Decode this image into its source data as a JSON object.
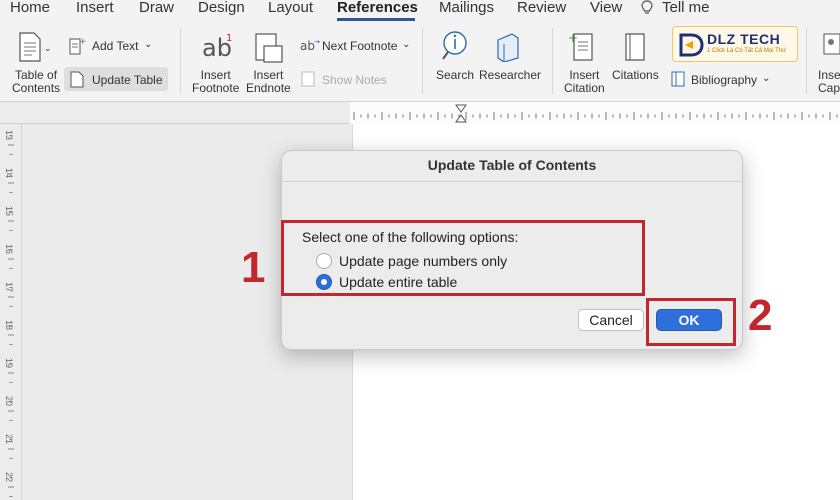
{
  "tabs": [
    "Home",
    "Insert",
    "Draw",
    "Design",
    "Layout",
    "References",
    "Mailings",
    "Review",
    "View",
    "Tell me"
  ],
  "active_tab": "References",
  "ribbon": {
    "table_of_contents": "Table of\nContents",
    "add_text": "Add Text",
    "update_table": "Update Table",
    "insert_footnote": "Insert\nFootnote",
    "insert_endnote": "Insert\nEndnote",
    "next_footnote": "Next Footnote",
    "show_notes": "Show Notes",
    "search": "Search",
    "researcher": "Researcher",
    "insert_citation": "Insert\nCitation",
    "citations": "Citations",
    "bibliography": "Bibliography",
    "insert_caption": "Inse\nCapt"
  },
  "ruler_numbers": [
    "13",
    "14",
    "15",
    "16",
    "17",
    "18",
    "19",
    "20",
    "21",
    "22"
  ],
  "dialog": {
    "title": "Update Table of Contents",
    "prompt": "Select one of the following options:",
    "options": [
      {
        "label": "Update page numbers only",
        "selected": false
      },
      {
        "label": "Update entire table",
        "selected": true
      }
    ],
    "cancel": "Cancel",
    "ok": "OK"
  },
  "annotations": {
    "step1": "1",
    "step2": "2",
    "color": "#c1272d"
  },
  "logo": {
    "name": "DLZ TECH",
    "tagline": "1 Click Là Có Tất Cả Mọi Thứ"
  },
  "colors": {
    "accent": "#2b579a",
    "ok_button": "#2f6fdc"
  }
}
